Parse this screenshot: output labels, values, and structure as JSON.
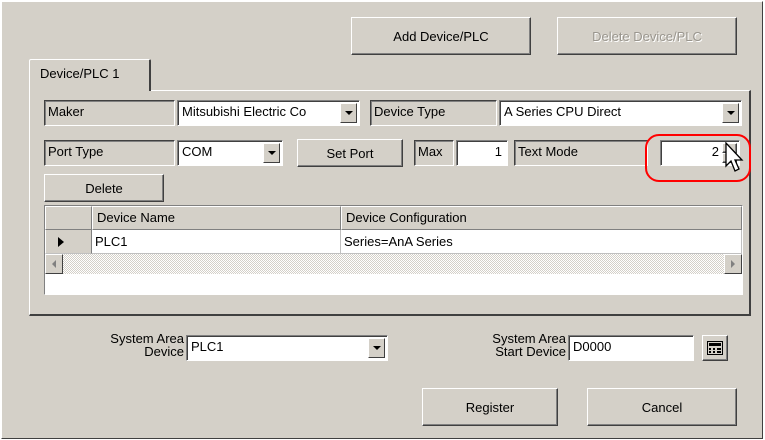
{
  "toolbar": {
    "add_device_label": "Add Device/PLC",
    "delete_device_label": "Delete Device/PLC"
  },
  "tab": {
    "label": "Device/PLC 1"
  },
  "settings": {
    "maker_label": "Maker",
    "maker_value": "Mitsubishi Electric Co",
    "device_type_label": "Device Type",
    "device_type_value": "A Series CPU Direct",
    "port_type_label": "Port Type",
    "port_type_value": "COM",
    "set_port_label": "Set Port",
    "max_label": "Max",
    "max_value": "1",
    "text_mode_label": "Text Mode",
    "text_mode_value": "2",
    "delete_label": "Delete"
  },
  "table": {
    "columns": [
      "Device Name",
      "Device Configuration"
    ],
    "rows": [
      {
        "device_name": "PLC1",
        "device_configuration": "Series=AnA Series"
      }
    ]
  },
  "system_area": {
    "device_label_line1": "System Area",
    "device_label_line2": "Device",
    "device_value": "PLC1",
    "start_label_line1": "System Area",
    "start_label_line2": "Start Device",
    "start_value": "D0000"
  },
  "footer": {
    "register_label": "Register",
    "cancel_label": "Cancel"
  },
  "colors": {
    "face": "#d4d0c8",
    "highlight": "#ff0000"
  }
}
